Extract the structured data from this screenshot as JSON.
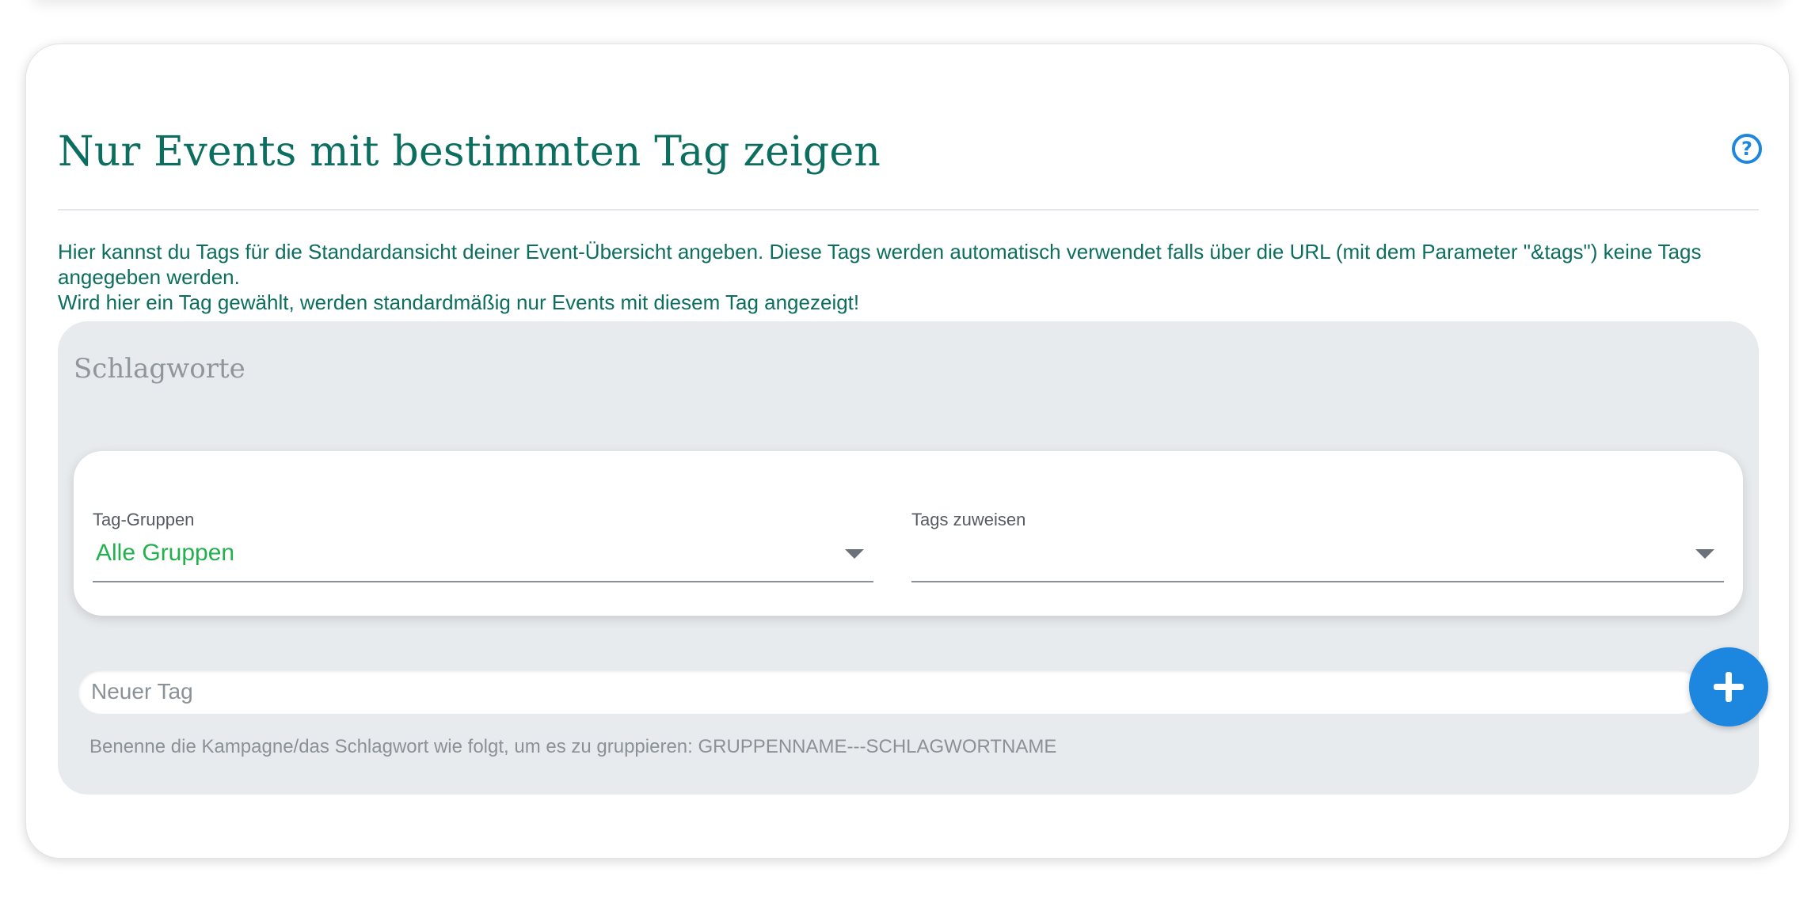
{
  "header": {
    "title": "Nur Events mit bestimmten Tag zeigen",
    "help_icon": "question-circle-icon",
    "help_glyph": "?"
  },
  "description": {
    "line1": "Hier kannst du Tags für die Standardansicht deiner Event-Übersicht angeben. Diese Tags werden automatisch verwendet falls über die URL (mit dem Parameter \"&tags\") keine Tags angegeben werden.",
    "line2": "Wird hier ein Tag gewählt, werden standardmäßig nur Events mit diesem Tag angezeigt!"
  },
  "tag_panel": {
    "title": "Schlagworte",
    "group_select": {
      "label": "Tag-Gruppen",
      "value": "Alle Gruppen"
    },
    "tags_select": {
      "label": "Tags zuweisen",
      "value": ""
    },
    "new_tag": {
      "placeholder": "Neuer Tag",
      "value": ""
    },
    "add_icon": "plus-icon",
    "hint": "Benenne die Kampagne/das Schlagwort wie folgt, um es zu gruppieren: GRUPPENNAME---SCHLAGWORTNAME"
  },
  "colors": {
    "title": "#0c6e5f",
    "accent": "#1d86de",
    "selected_value": "#22b14c",
    "panel_background": "#e8ebee"
  }
}
